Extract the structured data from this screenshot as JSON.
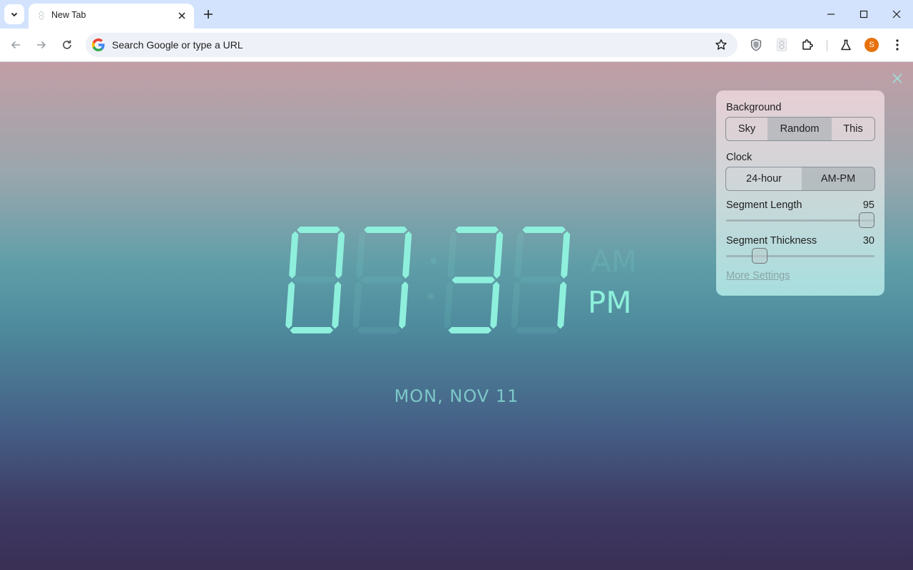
{
  "browser": {
    "tab_title": "New Tab",
    "omnibox_placeholder": "Search Google or type a URL",
    "profile_initial": "S"
  },
  "clock": {
    "hours": "07",
    "minutes": "37",
    "meridiem_on": "PM",
    "meridiem_off": "AM",
    "date": "MON, NOV 11",
    "segment_color": "#8ef0dc"
  },
  "settings": {
    "background_label": "Background",
    "background_options": [
      "Sky",
      "Random",
      "This"
    ],
    "background_selected": "Random",
    "clock_label": "Clock",
    "clock_options": [
      "24-hour",
      "AM-PM"
    ],
    "clock_selected": "AM-PM",
    "segment_length_label": "Segment Length",
    "segment_length_value": "95",
    "segment_thickness_label": "Segment Thickness",
    "segment_thickness_value": "30",
    "more_settings": "More Settings"
  },
  "icons": {
    "tab_search": "chevron-down-icon",
    "close": "close-icon",
    "new_tab": "plus-icon",
    "back": "arrow-left-icon",
    "forward": "arrow-right-icon",
    "reload": "reload-icon",
    "bookmark": "star-icon",
    "extensions": "puzzle-icon",
    "labs": "flask-icon",
    "menu": "kebab-menu-icon"
  }
}
